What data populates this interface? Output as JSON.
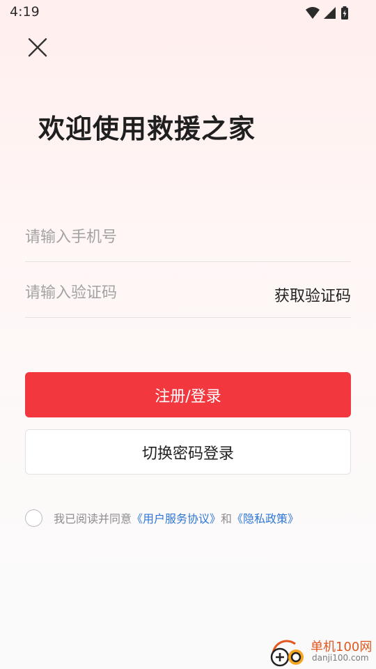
{
  "status_bar": {
    "time": "4:19",
    "icons": [
      "wifi-icon",
      "cell-signal-icon",
      "battery-charging-icon"
    ]
  },
  "header": {
    "close_icon": "close-icon"
  },
  "title": "欢迎使用救援之家",
  "form": {
    "phone": {
      "placeholder": "请输入手机号",
      "value": ""
    },
    "code": {
      "placeholder": "请输入验证码",
      "value": "",
      "get_code_label": "获取验证码"
    }
  },
  "buttons": {
    "primary_label": "注册/登录",
    "secondary_label": "切换密码登录"
  },
  "agreement": {
    "checked": false,
    "prefix": "我已阅读并同意",
    "terms_link": "《用户服务协议》",
    "conjunction": "和",
    "privacy_link": "《隐私政策》"
  },
  "watermark": {
    "name": "单机100网",
    "url": "danji100.com"
  },
  "colors": {
    "primary": "#f2373f",
    "link": "#2f77d6",
    "watermark": "#e2571e"
  }
}
